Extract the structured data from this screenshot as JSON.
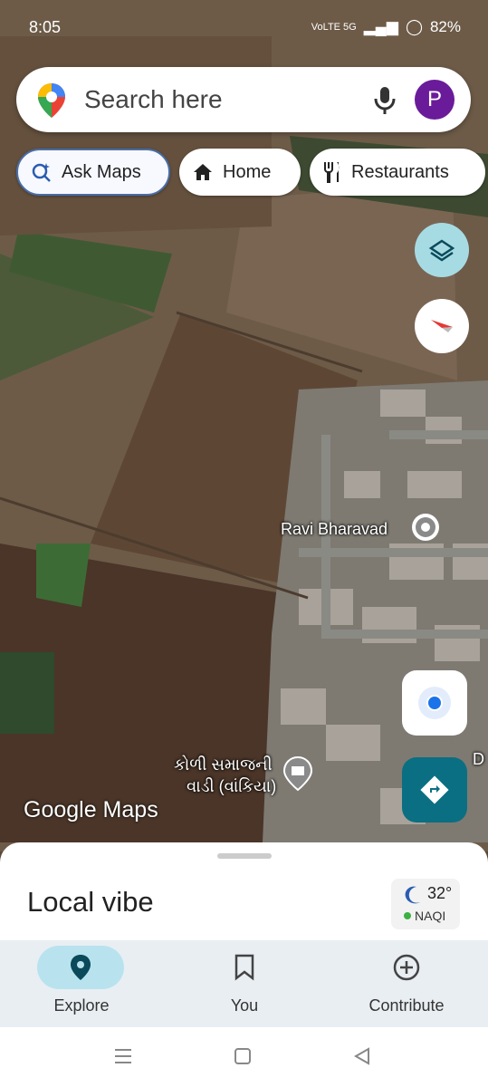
{
  "status": {
    "time": "8:05",
    "network": "VoLTE 5G",
    "battery": "82%"
  },
  "search": {
    "placeholder": "Search here",
    "avatar_letter": "P"
  },
  "chips": [
    {
      "label": "Ask Maps",
      "icon": "sparkle-search-icon"
    },
    {
      "label": "Home",
      "icon": "home-icon"
    },
    {
      "label": "Restaurants",
      "icon": "fork-knife-icon"
    }
  ],
  "map": {
    "place_label": "Ravi Bharavad",
    "poi_label_line1": "કોળી સમાજની",
    "poi_label_line2": "વાડી (વાંકિયા)",
    "edge_label": "D",
    "logo": "Google Maps"
  },
  "sheet": {
    "title": "Local vibe",
    "temperature": "32°",
    "aqi": "NAQI"
  },
  "nav": [
    {
      "label": "Explore",
      "icon": "explore-pin-icon",
      "active": true
    },
    {
      "label": "You",
      "icon": "bookmark-icon",
      "active": false
    },
    {
      "label": "Contribute",
      "icon": "plus-circle-icon",
      "active": false
    }
  ],
  "colors": {
    "accent": "#0a6f82",
    "avatar": "#6a1b9a",
    "active_pill": "#b8e3ee"
  }
}
